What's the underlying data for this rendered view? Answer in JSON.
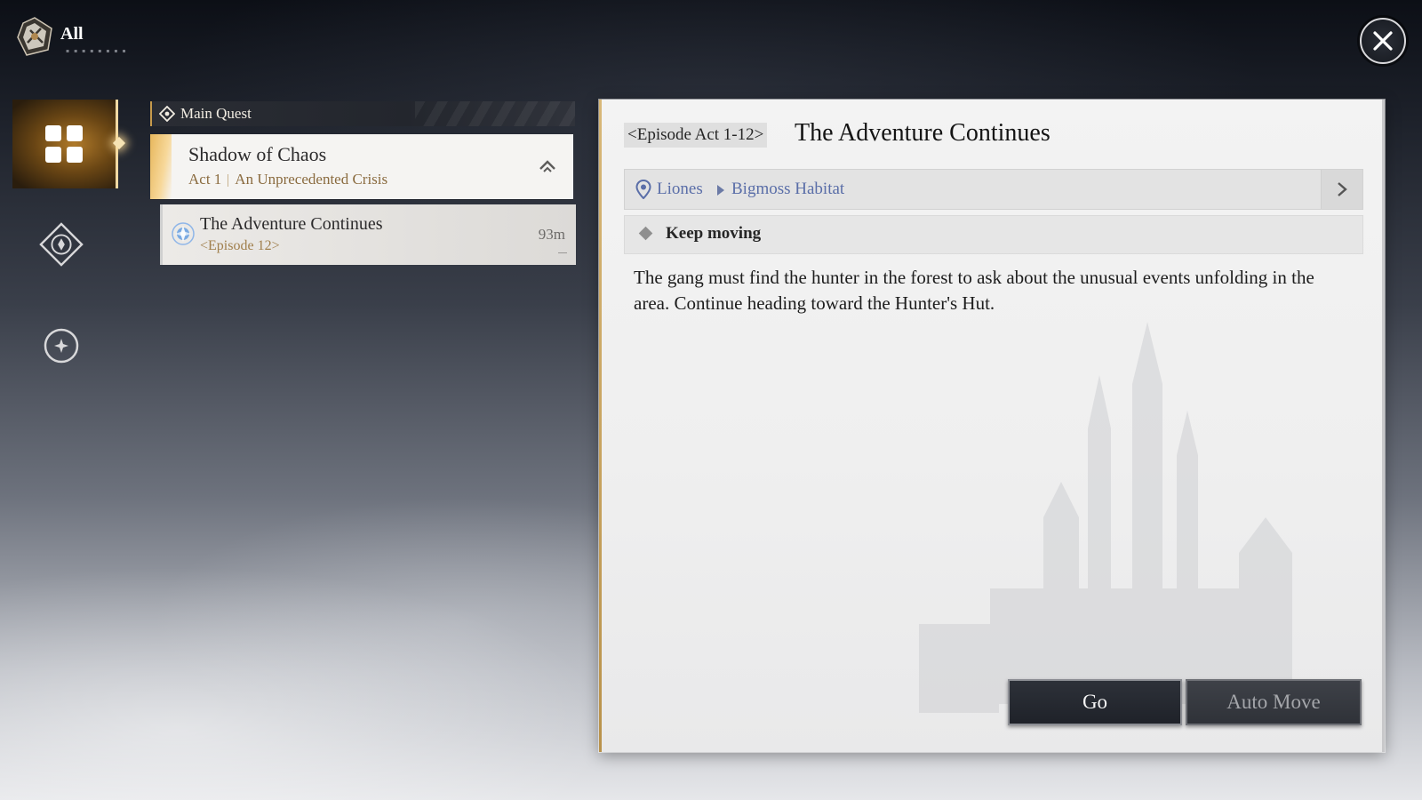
{
  "header": {
    "title": "All",
    "close_label": "Close"
  },
  "rail": {
    "items": [
      {
        "name": "all-quests",
        "active": true
      },
      {
        "name": "side-quests",
        "active": false
      },
      {
        "name": "other-quests",
        "active": false
      }
    ]
  },
  "quest_list": {
    "section_label": "Main Quest",
    "chapter": {
      "title": "Shadow of Chaos",
      "act": "Act 1",
      "subtitle": "An Unprecedented Crisis"
    },
    "items": [
      {
        "title": "The Adventure Continues",
        "episode": "<Episode 12>",
        "distance": "93m"
      }
    ]
  },
  "detail": {
    "episode_tag": "<Episode Act 1-12>",
    "title": "The Adventure Continues",
    "location": {
      "region": "Liones",
      "area": "Bigmoss Habitat"
    },
    "objective": "Keep moving",
    "description": "The gang must find the hunter in the forest to ask about the unusual events unfolding in the area. Continue heading toward the Hunter's Hut.",
    "buttons": {
      "go": "Go",
      "auto_move": "Auto Move"
    }
  },
  "colors": {
    "accent_gold": "#e7b75c",
    "location_link": "#5a6ea8",
    "episode_text": "#a07f4c"
  }
}
